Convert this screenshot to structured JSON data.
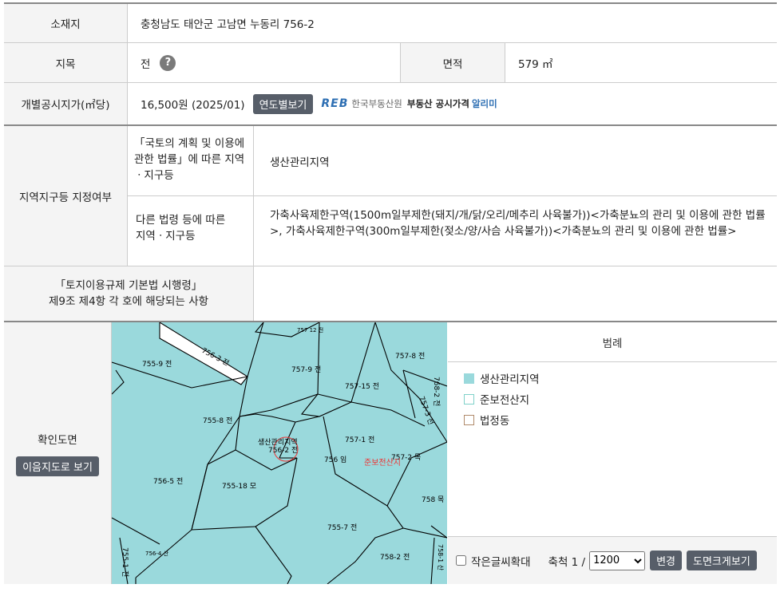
{
  "location": {
    "label": "소재지",
    "value": "충청남도 태안군 고남면 누동리 756-2"
  },
  "land_category": {
    "label": "지목",
    "value": "전",
    "help_icon": "question-icon"
  },
  "area": {
    "label": "면적",
    "value": "579 ㎡"
  },
  "official_price": {
    "label": "개별공시지가(㎡당)",
    "value": "16,500원 (2025/01)",
    "button": "연도별보기",
    "reb_logo": "REB",
    "reb_org": "한국부동산원",
    "reb_service": "부동산 공시가격",
    "reb_service_accent": "알리미"
  },
  "zoning": {
    "label": "지역지구등 지정여부",
    "national_law_label": "「국토의 계획 및 이용에 관한 법률」에 따른 지역ㆍ지구등",
    "national_law_value": "생산관리지역",
    "other_law_label": "다른 법령 등에 따른 지역ㆍ지구등",
    "other_law_value": "가축사육제한구역(1500m일부제한(돼지/개/닭/오리/메추리 사육불가))<가축분뇨의 관리 및 이용에 관한 법률>, 가축사육제한구역(300m일부제한(젖소/양/사슴 사육불가))<가축분뇨의 관리 및 이용에 관한 법률>"
  },
  "regulation": {
    "label_line1": "「토지이용규제 기본법 시행령」",
    "label_line2": "제9조 제4항 각 호에 해당되는 사항",
    "value": ""
  },
  "map_section": {
    "label": "확인도면",
    "button": "이음지도로 보기",
    "parcels": [
      "756-3 전",
      "757 12 전",
      "755-9 전",
      "757-9 전",
      "757-8 전",
      "768-2 전",
      "757-15 전",
      "757-3 전",
      "755-8 전",
      "생산관리지역",
      "756-2 전",
      "757-1 전",
      "756 임",
      "757-2 목",
      "준보전산지",
      "756-5 전",
      "755-18 모",
      "758 목",
      "755-7 전",
      "756-4 산",
      "755-1 전",
      "758-2 전",
      "758-1 산"
    ],
    "legend": {
      "title": "범례",
      "items": [
        {
          "label": "생산관리지역",
          "color": "#9ad9dc"
        },
        {
          "label": "준보전산지",
          "color": "#7fd1c9"
        },
        {
          "label": "법정동",
          "color": "#b08a6a"
        }
      ]
    },
    "controls": {
      "small_text_label": "작은글씨확대",
      "scale_label": "축척 1 /",
      "scale_value": "1200",
      "change_button": "변경",
      "large_map_button": "도면크게보기"
    }
  }
}
